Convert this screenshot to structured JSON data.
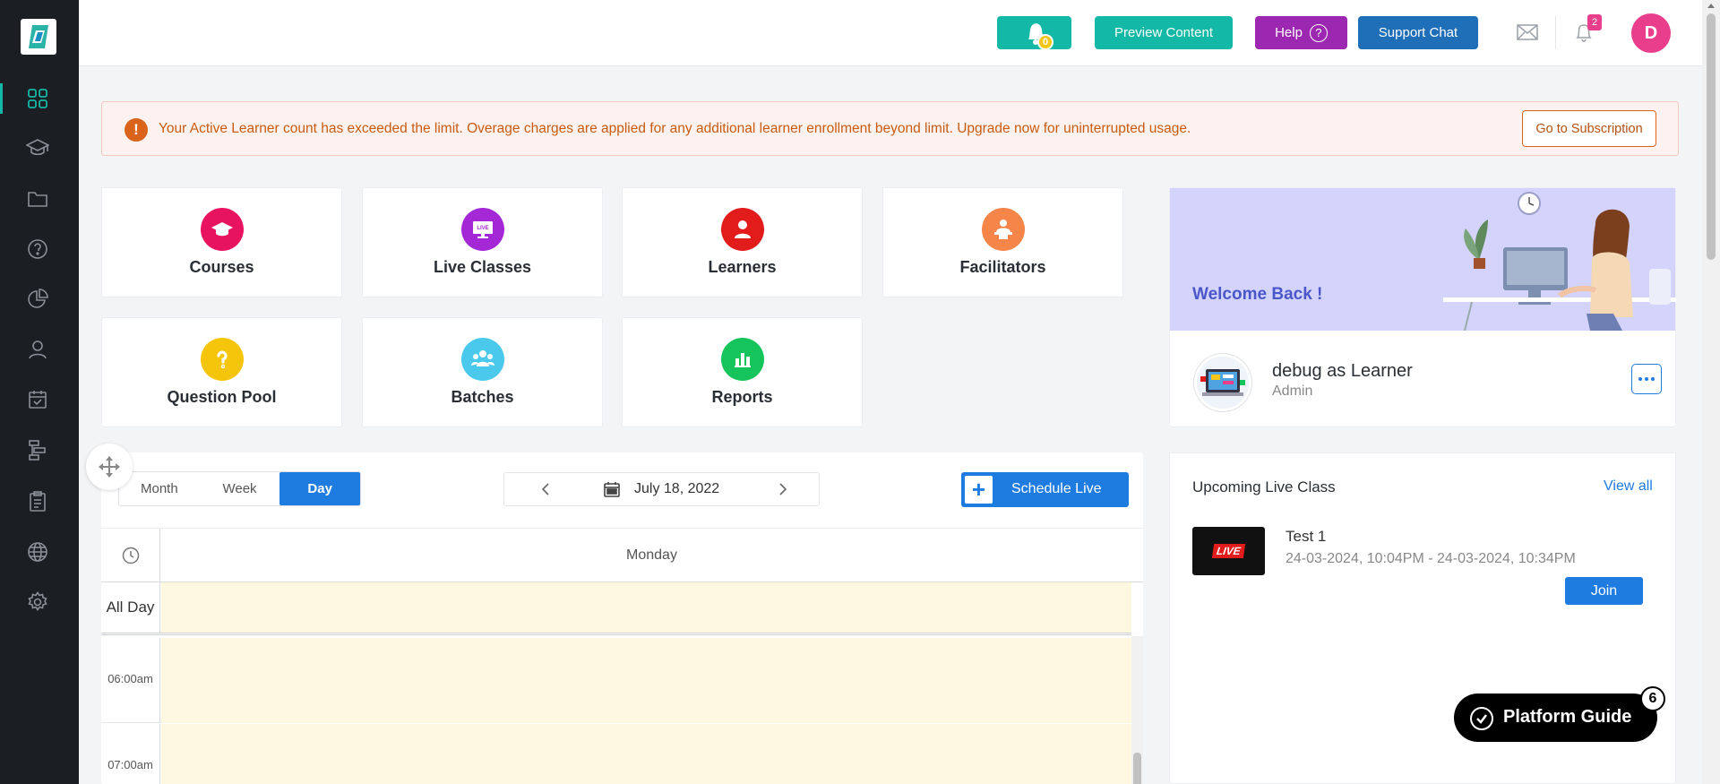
{
  "topbar": {
    "bell_count": "0",
    "preview_label": "Preview Content",
    "help_label": "Help",
    "help_icon": "?",
    "support_label": "Support Chat",
    "notification_count": "2",
    "avatar_initial": "D"
  },
  "alert": {
    "icon": "!",
    "message": "Your Active Learner count has exceeded the limit. Overage charges are applied for any additional learner enrollment beyond limit. Upgrade now for uninterrupted usage.",
    "button_label": "Go to Subscription"
  },
  "tiles": [
    {
      "label": "Courses",
      "color": "#e8135f",
      "icon": "graduation-cap-icon"
    },
    {
      "label": "Live Classes",
      "color": "#a428d6",
      "icon": "live-monitor-icon"
    },
    {
      "label": "Learners",
      "color": "#e21b1b",
      "icon": "learner-icon"
    },
    {
      "label": "Facilitators",
      "color": "#f58549",
      "icon": "facilitator-icon"
    },
    {
      "label": "Question Pool",
      "color": "#f5c50c",
      "icon": "question-icon"
    },
    {
      "label": "Batches",
      "color": "#4bc9ec",
      "icon": "group-icon"
    },
    {
      "label": "Reports",
      "color": "#15c45a",
      "icon": "bar-chart-icon"
    }
  ],
  "welcome": {
    "greeting": "Welcome Back !",
    "user_name": "debug as Learner",
    "user_role": "Admin"
  },
  "calendar": {
    "views": [
      "Month",
      "Week",
      "Day"
    ],
    "active_view": "Day",
    "date": "July 18, 2022",
    "schedule_label": "Schedule Live",
    "day_name": "Monday",
    "all_day_label": "All Day",
    "hours": [
      "06:00am",
      "07:00am"
    ]
  },
  "upcoming": {
    "title": "Upcoming Live Class",
    "view_all": "View all",
    "thumb_text": "LIVE",
    "class_name": "Test 1",
    "class_time": "24-03-2024, 10:04PM - 24-03-2024, 10:34PM",
    "join_label": "Join"
  },
  "guide": {
    "label": "Platform Guide",
    "count": "6"
  },
  "colors": {
    "sidebar": "#1b1e23",
    "teal": "#14b8a6",
    "purple": "#9c27b0",
    "blue": "#1e6eb8",
    "primary": "#1e7be0",
    "pink": "#e83e8c",
    "alert_text": "#c85b12"
  }
}
